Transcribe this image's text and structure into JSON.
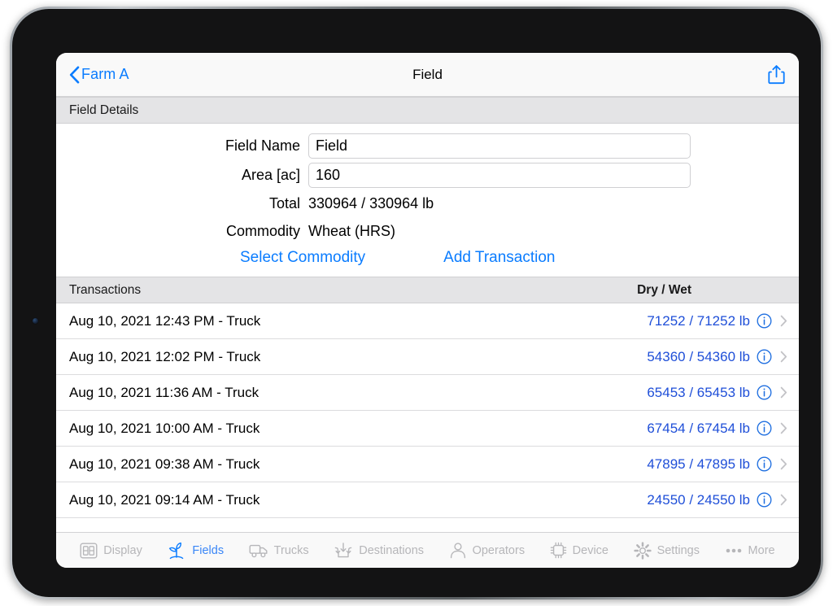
{
  "app": {
    "device": "ipad",
    "accent_color": "#0a7cff",
    "link_color": "#1f4fd8",
    "inactive_color": "#b6b6b9"
  },
  "navbar": {
    "back_label": "Farm A",
    "back_icon": "chevron-left-icon",
    "title": "Field",
    "share_icon": "share-icon"
  },
  "field_details": {
    "section_title": "Field Details",
    "rows": [
      {
        "label": "Field Name",
        "value": "Field",
        "placeholder": "Field Name",
        "type": "input"
      },
      {
        "label": "Area [ac]",
        "value": "160",
        "placeholder": "Area",
        "type": "input"
      },
      {
        "label": "Total",
        "value": "330964 / 330964 lb",
        "type": "static"
      },
      {
        "label": "Commodity",
        "value": "Wheat (HRS)",
        "type": "static"
      }
    ],
    "actions": [
      {
        "label": "Select Commodity",
        "name": "select-commodity-button"
      },
      {
        "label": "Add Transaction",
        "name": "add-transaction-button"
      }
    ]
  },
  "transactions": {
    "section_title": "Transactions",
    "column_right": "Dry / Wet",
    "rows": [
      {
        "title": "Aug 10, 2021 12:43 PM - Truck",
        "amount": "71252 / 71252 lb",
        "info_icon": "info-circle-icon",
        "chevron": "chevron-right-icon"
      },
      {
        "title": "Aug 10, 2021 12:02 PM - Truck",
        "amount": "54360 / 54360 lb",
        "info_icon": "info-circle-icon",
        "chevron": "chevron-right-icon"
      },
      {
        "title": "Aug 10, 2021 11:36 AM - Truck",
        "amount": "65453 / 65453 lb",
        "info_icon": "info-circle-icon",
        "chevron": "chevron-right-icon"
      },
      {
        "title": "Aug 10, 2021 10:00 AM - Truck",
        "amount": "67454 / 67454 lb",
        "info_icon": "info-circle-icon",
        "chevron": "chevron-right-icon"
      },
      {
        "title": "Aug 10, 2021 09:38 AM - Truck",
        "amount": "47895 / 47895 lb",
        "info_icon": "info-circle-icon",
        "chevron": "chevron-right-icon"
      },
      {
        "title": "Aug 10, 2021 09:14 AM - Truck",
        "amount": "24550 / 24550 lb",
        "info_icon": "info-circle-icon",
        "chevron": "chevron-right-icon"
      }
    ]
  },
  "tabbar": {
    "items": [
      {
        "label": "Display",
        "icon": "display-icon",
        "active": false
      },
      {
        "label": "Fields",
        "icon": "sprout-icon",
        "active": true
      },
      {
        "label": "Trucks",
        "icon": "truck-icon",
        "active": false
      },
      {
        "label": "Destinations",
        "icon": "destination-icon",
        "active": false
      },
      {
        "label": "Operators",
        "icon": "person-icon",
        "active": false
      },
      {
        "label": "Device",
        "icon": "chip-icon",
        "active": false
      },
      {
        "label": "Settings",
        "icon": "gear-icon",
        "active": false
      },
      {
        "label": "More",
        "icon": "ellipsis-icon",
        "active": false
      }
    ]
  }
}
